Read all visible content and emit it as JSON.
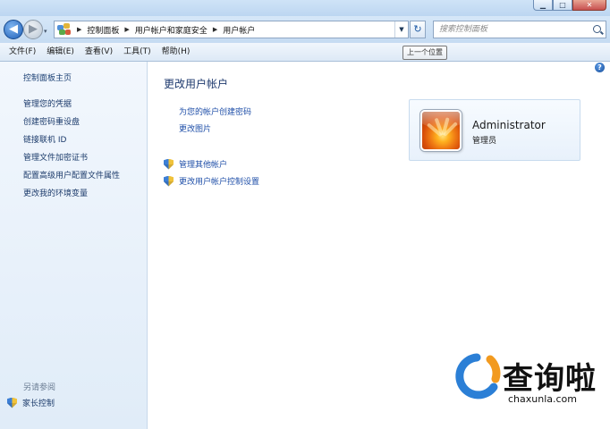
{
  "window": {
    "buttons": {
      "minimize": "▁",
      "maximize": "□",
      "close": "✕"
    }
  },
  "nav": {
    "back_glyph": "◀",
    "forward_glyph": "▶",
    "history_glyph": "▾",
    "breadcrumbs": [
      "控制面板",
      "用户帐户和家庭安全",
      "用户帐户"
    ],
    "separator": "▶",
    "dropdown_glyph": "▼",
    "refresh_glyph": "↻",
    "search_placeholder": "搜索控制面板",
    "tooltip": "上一个位置"
  },
  "menu": [
    "文件(F)",
    "编辑(E)",
    "查看(V)",
    "工具(T)",
    "帮助(H)"
  ],
  "sidebar": {
    "home": "控制面板主页",
    "links": [
      "管理您的凭据",
      "创建密码重设盘",
      "链接联机 ID",
      "管理文件加密证书",
      "配置高级用户配置文件属性",
      "更改我的环境变量"
    ],
    "see_also": "另请参阅",
    "parental_controls": "家长控制"
  },
  "main": {
    "help_glyph": "?",
    "title": "更改用户帐户",
    "links": [
      "为您的帐户创建密码",
      "更改图片"
    ],
    "admin_links": [
      "管理其他帐户",
      "更改用户帐户控制设置"
    ]
  },
  "user": {
    "name": "Administrator",
    "role": "管理员"
  },
  "watermark": {
    "word": "查询啦",
    "url": "chaxunla.com"
  },
  "colors": {
    "link": "#1f4fa8",
    "title": "#1e3a6e",
    "sidebar_bg": "#e6eff9"
  }
}
